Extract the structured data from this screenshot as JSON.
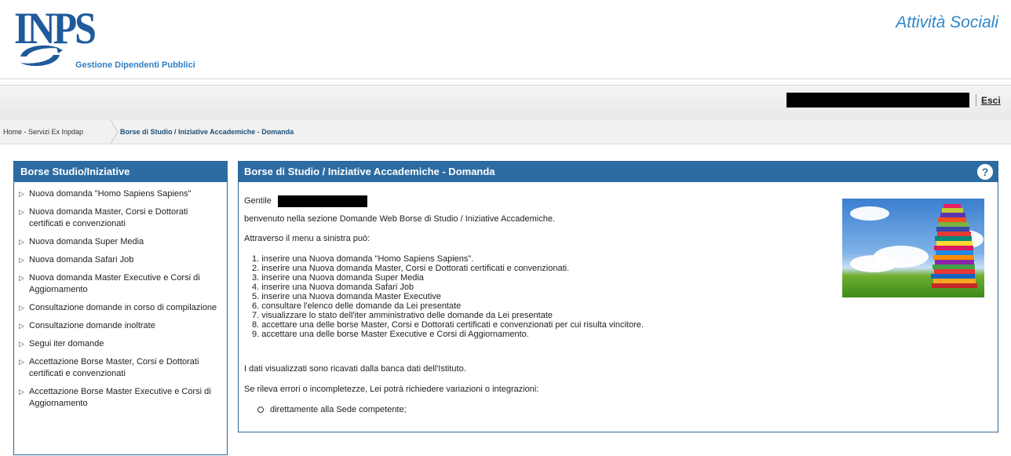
{
  "header": {
    "logo_text": "INPS",
    "subtitle": "Gestione Dipendenti Pubblici",
    "app_title": "Attività Sociali"
  },
  "userbar": {
    "logout_label": "Esci"
  },
  "breadcrumb": {
    "home": "Home - Servizi Ex Inpdap",
    "current": "Borse di Studio / Iniziative Accademiche - Domanda"
  },
  "sidebar": {
    "title": "Borse Studio/Iniziative",
    "items": [
      "Nuova domanda \"Homo Sapiens Sapiens\"",
      "Nuova domanda Master, Corsi e Dottorati certificati e convenzionati",
      "Nuova domanda Super Media",
      "Nuova domanda Safari Job",
      "Nuova domanda Master Executive e Corsi di Aggiornamento",
      "Consultazione domande in corso di compilazione",
      "Consultazione domande inoltrate",
      "Segui iter domande",
      "Accettazione Borse Master, Corsi e Dottorati certificati e convenzionati",
      "Accettazione Borse Master Executive e Corsi di Aggiornamento"
    ]
  },
  "main": {
    "title": "Borse di Studio / Iniziative Accademiche - Domanda",
    "help_icon": "?",
    "greeting": "Gentile",
    "welcome": "benvenuto nella sezione Domande Web Borse di Studio / Iniziative Accademiche.",
    "intro": "Attraverso il menu a sinistra può:",
    "steps": [
      "1. inserire una Nuova domanda \"Homo Sapiens Sapiens\".",
      "2. inserire una Nuova domanda Master, Corsi e Dottorati certificati e convenzionati.",
      "3. inserire una Nuova domanda Super Media",
      "4. inserire una Nuova domanda Safari Job",
      "5. inserire una Nuova domanda Master Executive",
      "6. consultare l'elenco delle domande da Lei presentate",
      "7. visualizzare lo stato dell'iter amministrativo delle domande da Lei presentate",
      "8. accettare una delle borse Master, Corsi e Dottorati certificati e convenzionati per cui risulta vincitore.",
      "9. accettare una delle borse Master Executive e Corsi di Aggiornamento."
    ],
    "data_note": "I dati visualizzati sono ricavati dalla banca dati dell'Istituto.",
    "errors_note": "Se rileva errori o incompletezze, Lei potrà richiedere variazioni o integrazioni:",
    "contact_item": "direttamente alla Sede competente;"
  },
  "colors": {
    "panel_header": "#2d6ca2",
    "brand_blue": "#1f5a9c",
    "title_blue": "#2f86c8"
  }
}
